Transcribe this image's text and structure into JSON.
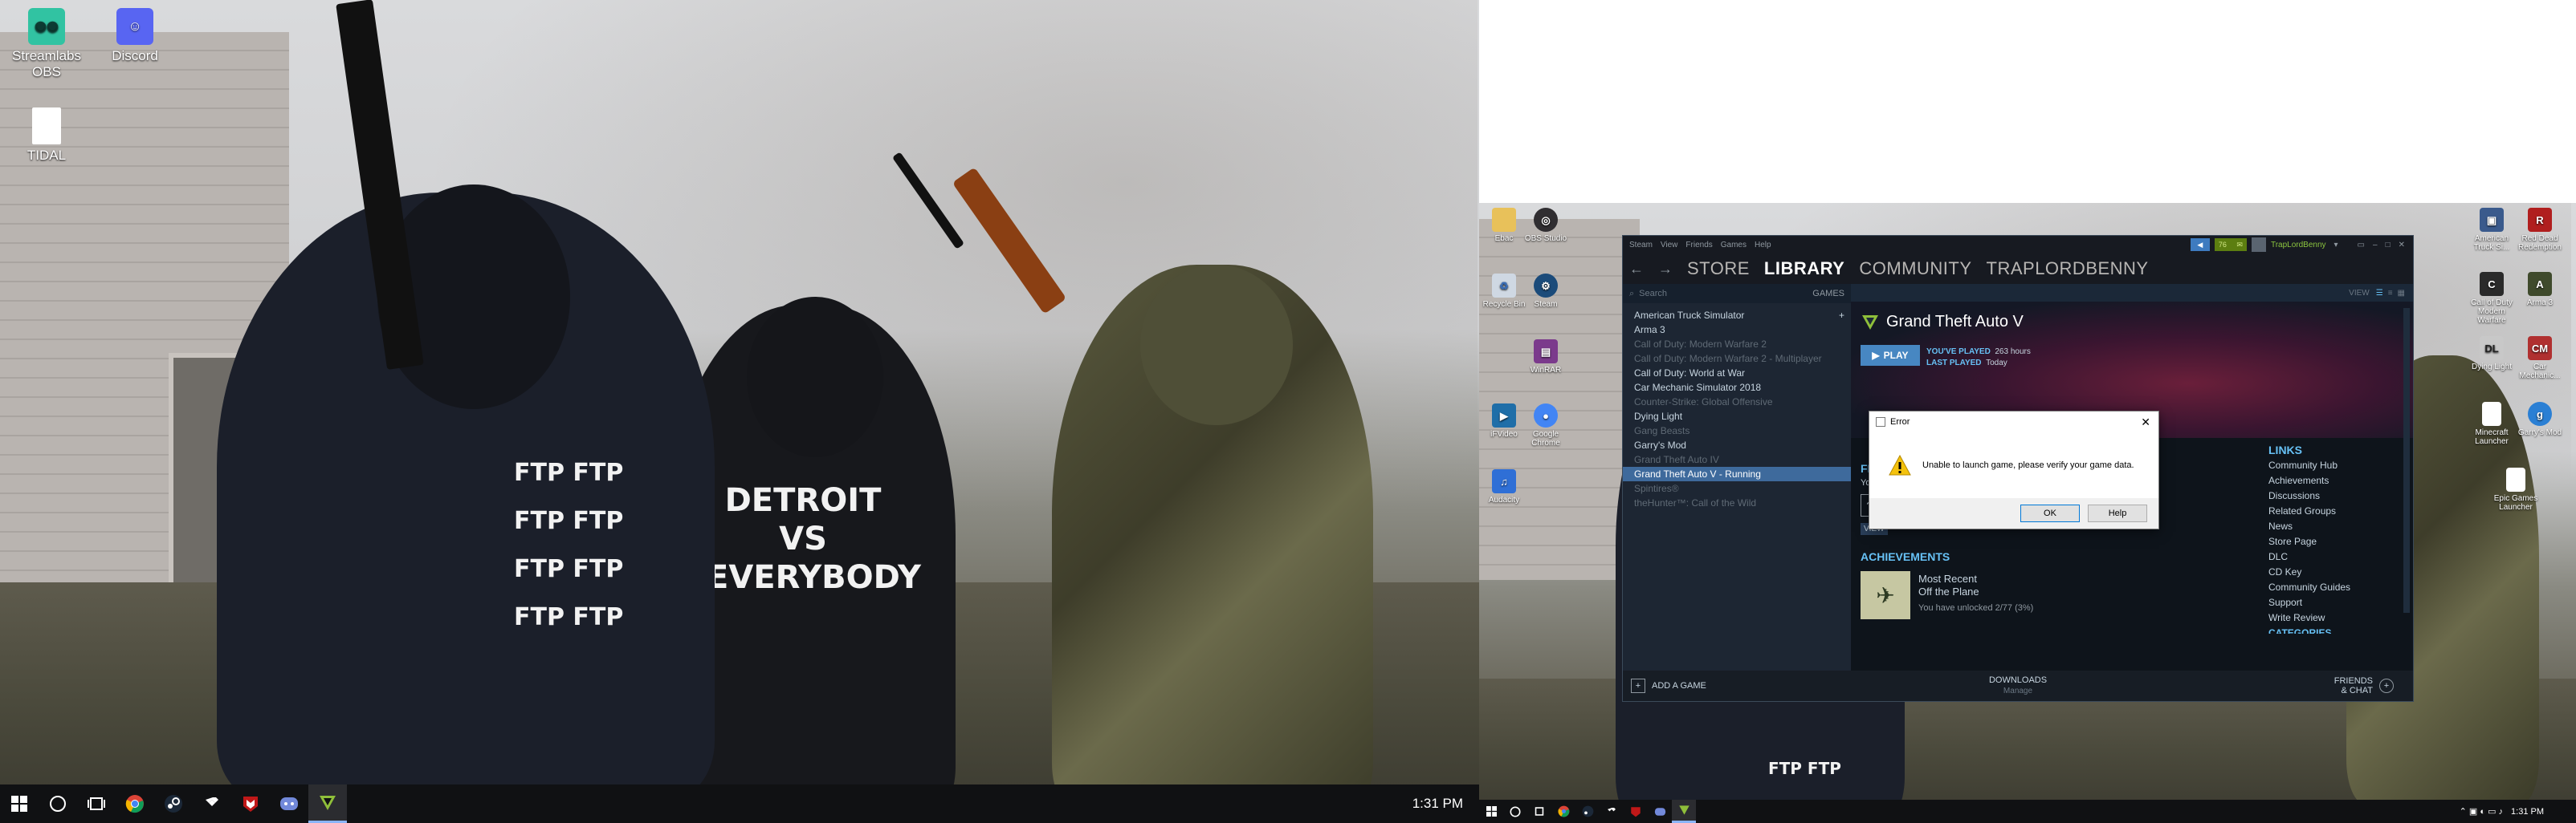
{
  "monitor1": {
    "desktop_icons": [
      {
        "label": "Streamlabs OBS",
        "icon": "streamlabs-icon",
        "color": "#31c3a2"
      },
      {
        "label": "Discord",
        "icon": "discord-icon",
        "color": "#5865f2"
      },
      {
        "label": "TIDAL",
        "icon": "file-icon",
        "color": "#ffffff"
      }
    ],
    "taskbar": {
      "clock": "1:31 PM",
      "items": [
        "start-icon",
        "search-circle-icon",
        "task-view-icon",
        "chrome-icon",
        "steam-icon",
        "tidal-icon",
        "mcafee-icon",
        "discord-icon",
        "gta-icon"
      ]
    }
  },
  "monitor2": {
    "desktop_icons_left": [
      {
        "label": "Ebac",
        "icon": "folder-icon",
        "color": "#e8c15a"
      },
      {
        "label": "OBS Studio",
        "icon": "obs-icon",
        "color": "#302e31"
      },
      {
        "label": "Recycle Bin",
        "icon": "recycle-bin-icon",
        "color": "#cfd8e3"
      },
      {
        "label": "Steam",
        "icon": "steam-icon",
        "color": "#1b4b7a"
      },
      {
        "label": "WinRAR",
        "icon": "winrar-icon",
        "color": "#7b3a8c"
      },
      {
        "label": "iFVideo",
        "icon": "video-icon",
        "color": "#1f6ea8"
      },
      {
        "label": "Google Chrome",
        "icon": "chrome-icon",
        "color": "#4285f4"
      },
      {
        "label": "Audacity",
        "icon": "audacity-icon",
        "color": "#2f6fd6"
      }
    ],
    "desktop_icons_right": [
      {
        "label": "American Truck Si...",
        "icon": "truck-icon",
        "color": "#3a5a8c"
      },
      {
        "label": "Red Dead Redemption",
        "icon": "rdr-icon",
        "color": "#b01e1e"
      },
      {
        "label": "Call of Duty Modern Warfare",
        "icon": "cod-icon",
        "color": "#2a2a2a"
      },
      {
        "label": "Arma 3",
        "icon": "arma-icon",
        "color": "#3f4a2c"
      },
      {
        "label": "Dying Light",
        "icon": "dying-light-icon",
        "color": "#c8c8c8"
      },
      {
        "label": "Car Mechanic...",
        "icon": "car-mechanic-icon",
        "color": "#b03030"
      },
      {
        "label": "Minecraft Launcher",
        "icon": "file-icon",
        "color": "#ffffff"
      },
      {
        "label": "Garry's Mod",
        "icon": "gmod-icon",
        "color": "#2a7fd4"
      },
      {
        "label": "Epic Games Launcher",
        "icon": "file-icon",
        "color": "#ffffff"
      }
    ],
    "taskbar": {
      "clock": "1:31 PM",
      "items": [
        "start-icon",
        "search-circle-icon",
        "task-view-icon",
        "chrome-icon",
        "steam-icon",
        "tidal-icon",
        "mcafee-icon",
        "discord-icon",
        "gta-icon"
      ]
    }
  },
  "steam": {
    "menu": [
      "Steam",
      "View",
      "Friends",
      "Games",
      "Help"
    ],
    "notification_count": "76",
    "username": "TrapLordBenny",
    "nav": [
      "STORE",
      "LIBRARY",
      "COMMUNITY",
      "TRAPLORDBENNY"
    ],
    "search_placeholder": "Search",
    "games_label": "GAMES",
    "view_label": "VIEW",
    "games": [
      {
        "name": "American Truck Simulator",
        "state": "installed"
      },
      {
        "name": "Arma 3",
        "state": "installed"
      },
      {
        "name": "Call of Duty: Modern Warfare 2",
        "state": "dim"
      },
      {
        "name": "Call of Duty: Modern Warfare 2 - Multiplayer",
        "state": "dim"
      },
      {
        "name": "Call of Duty: World at War",
        "state": "installed"
      },
      {
        "name": "Car Mechanic Simulator 2018",
        "state": "installed"
      },
      {
        "name": "Counter-Strike: Global Offensive",
        "state": "dim"
      },
      {
        "name": "Dying Light",
        "state": "installed"
      },
      {
        "name": "Gang Beasts",
        "state": "dim"
      },
      {
        "name": "Garry's Mod",
        "state": "installed"
      },
      {
        "name": "Grand Theft Auto IV",
        "state": "dim"
      },
      {
        "name": "Grand Theft Auto V - Running",
        "state": "selected"
      },
      {
        "name": "Spintires®",
        "state": "dim"
      },
      {
        "name": "theHunter™: Call of the Wild",
        "state": "dim"
      }
    ],
    "game_title": "Grand Theft Auto V",
    "play_label": "PLAY",
    "played_label": "YOU'VE PLAYED",
    "played_value": "263 hours",
    "last_played_label": "LAST PLAYED",
    "last_played_value": "Today",
    "friends_heading": "FRIE",
    "friends_text": "You h",
    "view_btn": "VIEW",
    "achievements_heading": "ACHIEVEMENTS",
    "ach_recent": "Most Recent",
    "ach_name": "Off the Plane",
    "ach_progress": "You have unlocked 2/77 (3%)",
    "links_heading": "LINKS",
    "links": [
      "Community Hub",
      "Achievements",
      "Discussions",
      "Related Groups",
      "News",
      "Store Page",
      "DLC",
      "CD Key",
      "Community Guides",
      "Support",
      "Write Review"
    ],
    "categories_heading": "CATEGORIES",
    "add_game": "ADD A GAME",
    "downloads": "DOWNLOADS",
    "downloads_sub": "Manage",
    "friends_chat_1": "FRIENDS",
    "friends_chat_2": "& CHAT"
  },
  "dialog": {
    "title": "Error",
    "message": "Unable to launch game, please verify your game data.",
    "ok": "OK",
    "help": "Help"
  }
}
